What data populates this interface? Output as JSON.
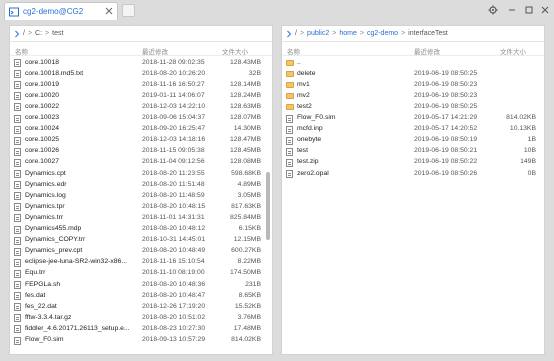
{
  "window": {
    "tab_title": "cg2-demo@CG2",
    "icons": {
      "tab": "terminal-icon",
      "close": "close-icon",
      "settings": "gear-icon",
      "minimize": "minimize-icon",
      "maximize": "maximize-icon"
    }
  },
  "left_pane": {
    "path": {
      "root": "/",
      "drive": "C:",
      "folder": "test"
    },
    "columns": {
      "name": "名称",
      "date": "最近修改",
      "size": "文件大小"
    },
    "files": [
      {
        "name": "core.10018",
        "date": "2018-11-28 09:02:35",
        "size": "128.43MB",
        "type": "file"
      },
      {
        "name": "core.10018.md5.txt",
        "date": "2018-08-20 10:26:20",
        "size": "32B",
        "type": "file"
      },
      {
        "name": "core.10019",
        "date": "2018-11-16 16:50:27",
        "size": "128.14MB",
        "type": "file"
      },
      {
        "name": "core.10020",
        "date": "2019-01-11 14:06:07",
        "size": "128.24MB",
        "type": "file"
      },
      {
        "name": "core.10022",
        "date": "2018-12-03 14:22:10",
        "size": "128.63MB",
        "type": "file"
      },
      {
        "name": "core.10023",
        "date": "2018-09-06 15:04:37",
        "size": "128.07MB",
        "type": "file"
      },
      {
        "name": "core.10024",
        "date": "2018-09-20 16:25:47",
        "size": "14.30MB",
        "type": "file"
      },
      {
        "name": "core.10025",
        "date": "2018-12-03 14:18:16",
        "size": "128.47MB",
        "type": "file"
      },
      {
        "name": "core.10026",
        "date": "2018-11-15 09:05:38",
        "size": "128.45MB",
        "type": "file"
      },
      {
        "name": "core.10027",
        "date": "2018-11-04 09:12:56",
        "size": "128.08MB",
        "type": "file"
      },
      {
        "name": "Dynamics.cpt",
        "date": "2018-08-20 11:23:55",
        "size": "598.68KB",
        "type": "file"
      },
      {
        "name": "Dynamics.edr",
        "date": "2018-08-20 11:51:48",
        "size": "4.89MB",
        "type": "file"
      },
      {
        "name": "Dynamics.log",
        "date": "2018-08-20 11:48:59",
        "size": "3.05MB",
        "type": "file"
      },
      {
        "name": "Dynamics.tpr",
        "date": "2018-08-20 10:48:15",
        "size": "817.63KB",
        "type": "file"
      },
      {
        "name": "Dynamics.trr",
        "date": "2018-11-01 14:31:31",
        "size": "825.84MB",
        "type": "file"
      },
      {
        "name": "Dynamics455.mdp",
        "date": "2018-08-20 10:48:12",
        "size": "6.15KB",
        "type": "file"
      },
      {
        "name": "Dynamics_COPY.trr",
        "date": "2018-10-31 14:45:01",
        "size": "12.15MB",
        "type": "file"
      },
      {
        "name": "Dynamics_prev.cpt",
        "date": "2018-08-20 10:48:49",
        "size": "600.27KB",
        "type": "file"
      },
      {
        "name": "eclipse-jee-luna-SR2-win32-x86...",
        "date": "2018-11-16 15:10:54",
        "size": "8.22MB",
        "type": "file"
      },
      {
        "name": "Equ.trr",
        "date": "2018-11-10 08:19:00",
        "size": "174.50MB",
        "type": "file"
      },
      {
        "name": "FEPGLa.sh",
        "date": "2018-08-20 10:48:36",
        "size": "231B",
        "type": "file"
      },
      {
        "name": "fes.dat",
        "date": "2018-08-20 10:48:47",
        "size": "8.65KB",
        "type": "file"
      },
      {
        "name": "fes_22.dat",
        "date": "2018-12-26 17:19:20",
        "size": "15.52KB",
        "type": "file"
      },
      {
        "name": "fftw-3.3.4.tar.gz",
        "date": "2018-08-20 10:51:02",
        "size": "3.76MB",
        "type": "file"
      },
      {
        "name": "fiddler_4.6.20171.26113_setup.e...",
        "date": "2018-08-23 10:27:30",
        "size": "17.48MB",
        "type": "file"
      },
      {
        "name": "Flow_F0.sim",
        "date": "2018-09-13 10:57:29",
        "size": "814.02KB",
        "type": "file"
      }
    ]
  },
  "right_pane": {
    "path": {
      "root": "/",
      "segments": [
        "public2",
        "home",
        "cg2-demo",
        "interfaceTest"
      ]
    },
    "columns": {
      "name": "名称",
      "date": "最近修改",
      "size": "文件大小"
    },
    "files": [
      {
        "name": "..",
        "date": "",
        "size": "",
        "type": "folder"
      },
      {
        "name": "delete",
        "date": "2019-06-19 08:50:25",
        "size": "",
        "type": "folder"
      },
      {
        "name": "mv1",
        "date": "2019-06-19 08:50:23",
        "size": "",
        "type": "folder"
      },
      {
        "name": "mv2",
        "date": "2019-06-19 08:50:23",
        "size": "",
        "type": "folder"
      },
      {
        "name": "test2",
        "date": "2019-06-19 08:50:25",
        "size": "",
        "type": "folder"
      },
      {
        "name": "Flow_F0.sim",
        "date": "2019-05-17 14:21:29",
        "size": "814.02KB",
        "type": "file"
      },
      {
        "name": "mcfd.inp",
        "date": "2019-05-17 14:20:52",
        "size": "10.13KB",
        "type": "file"
      },
      {
        "name": "onebyte",
        "date": "2019-06-19 08:50:19",
        "size": "1B",
        "type": "file"
      },
      {
        "name": "test",
        "date": "2019-06-19 08:50:21",
        "size": "10B",
        "type": "file"
      },
      {
        "name": "test.zip",
        "date": "2019-06-19 08:50:22",
        "size": "149B",
        "type": "file"
      },
      {
        "name": "zero2.opal",
        "date": "2019-06-19 08:50:26",
        "size": "0B",
        "type": "file"
      }
    ]
  }
}
